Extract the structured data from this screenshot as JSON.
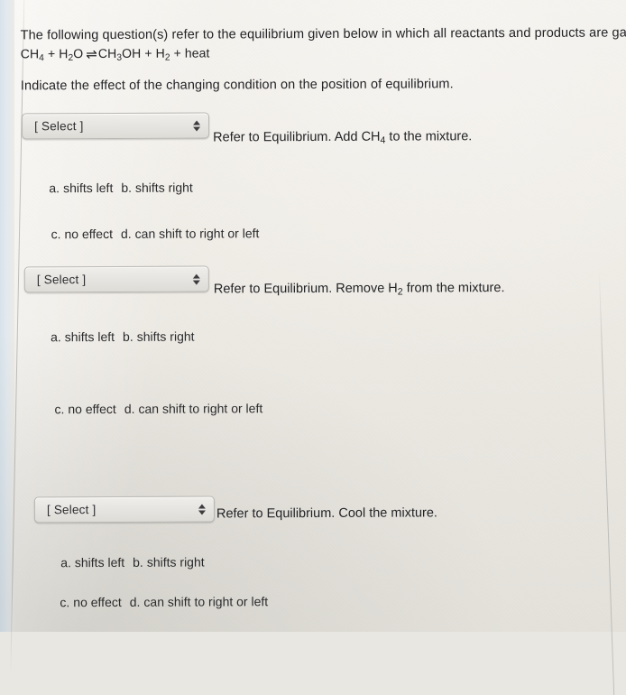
{
  "stem": {
    "line1": "The following question(s) refer to the equilibrium given below in which all reactants and products are gases.",
    "equation_plain": "CH4 + H2O ⇌ CH3OH + H2 + heat",
    "equation_parts": {
      "reactant1": "CH",
      "reactant1_sub": "4",
      "plus1": " + ",
      "reactant2": "H",
      "reactant2_sub": "2",
      "reactant2_tail": "O",
      "arrow": "⇌",
      "product1": "CH",
      "product1_sub": "3",
      "product1_tail": "OH",
      "plus2": " + ",
      "product2": "H",
      "product2_sub": "2",
      "plus3": " + ",
      "product3": "heat"
    },
    "instruction": "Indicate the effect of the changing condition on the position of equilibrium."
  },
  "select_placeholder": "[ Select ]",
  "questions": [
    {
      "id": 1,
      "select_value": "[ Select ]",
      "prompt_prefix": "Refer to Equilibrium. Add CH",
      "prompt_sub": "4",
      "prompt_suffix": " to the mixture.",
      "prompt_plain": "Refer to Equilibrium. Add CH4 to the mixture.",
      "options_row1": {
        "a_key": "a.",
        "a_text": "shifts left",
        "b_key": "b.",
        "b_text": "shifts right"
      },
      "options_row2": {
        "c_key": "c.",
        "c_text": "no effect",
        "d_key": "d.",
        "d_text": "can shift to right or left"
      }
    },
    {
      "id": 2,
      "select_value": "[ Select ]",
      "prompt_prefix": "Refer to Equilibrium. Remove H",
      "prompt_sub": "2",
      "prompt_suffix": " from the mixture.",
      "prompt_plain": "Refer to Equilibrium. Remove H2 from the mixture.",
      "options_row1": {
        "a_key": "a.",
        "a_text": "shifts left",
        "b_key": "b.",
        "b_text": "shifts right"
      },
      "options_row2": {
        "c_key": "c.",
        "c_text": "no effect",
        "d_key": "d.",
        "d_text": "can shift to right or left"
      }
    },
    {
      "id": 3,
      "select_value": "[ Select ]",
      "prompt_prefix": "Refer to Equilibrium. Cool the mixture.",
      "prompt_sub": "",
      "prompt_suffix": "",
      "prompt_plain": "Refer to Equilibrium. Cool the mixture.",
      "options_row1": {
        "a_key": "a.",
        "a_text": "shifts left",
        "b_key": "b.",
        "b_text": "shifts right"
      },
      "options_row2": {
        "c_key": "c.",
        "c_text": "no effect",
        "d_key": "d.",
        "d_text": "can shift to right or left"
      }
    }
  ],
  "colors": {
    "page_background": "#efece6",
    "text": "#232326",
    "select_face": "#e7e5e1",
    "select_border": "#b9b7b2"
  }
}
